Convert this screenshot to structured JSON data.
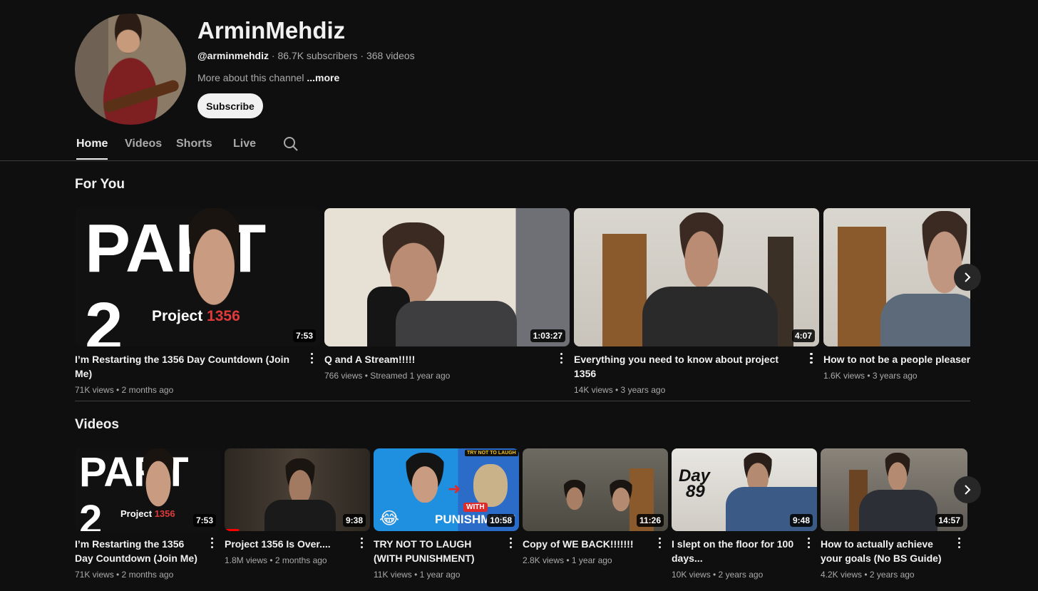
{
  "channel": {
    "name": "ArminMehdiz",
    "handle": "@arminmehdiz",
    "stats": " · 86.7K subscribers · 368 videos",
    "about": "More about this channel ",
    "about_more": "...more",
    "subscribe_label": "Subscribe"
  },
  "tabs": [
    {
      "label": "Home",
      "active": true
    },
    {
      "label": "Videos",
      "active": false
    },
    {
      "label": "Shorts",
      "active": false
    },
    {
      "label": "Live",
      "active": false
    }
  ],
  "sections": {
    "for_you": {
      "title": "For You",
      "videos": [
        {
          "title": "I’m Restarting the 1356 Day Countdown (Join Me)",
          "meta": "71K views • 2 months ago",
          "duration": "7:53",
          "thumb_text": "PART 2",
          "thumb_sub": "Project",
          "thumb_sub_num": "1356"
        },
        {
          "title": "Q and A Stream!!!!!",
          "meta": "766 views • Streamed 1 year ago",
          "duration": "1:03:27"
        },
        {
          "title": "Everything you need to know about project 1356",
          "meta": "14K views • 3 years ago",
          "duration": "4:07"
        },
        {
          "title": "How to not be a people pleaser",
          "meta": "1.6K views • 3 years ago",
          "duration": ""
        }
      ]
    },
    "videos": {
      "title": "Videos",
      "videos": [
        {
          "title": "I’m Restarting the 1356 Day Countdown (Join Me)",
          "meta": "71K views • 2 months ago",
          "duration": "7:53",
          "thumb_text": "PART 2",
          "thumb_sub": "Project",
          "thumb_sub_num": "1356"
        },
        {
          "title": "Project 1356 Is Over....",
          "meta": "1.8M views • 2 months ago",
          "duration": "9:38",
          "progress": 0.1
        },
        {
          "title": "TRY NOT TO LAUGH (WITH PUNISHMENT)",
          "meta": "11K views • 1 year ago",
          "duration": "10:58",
          "thumb_tag": "TRY NOT TO LAUGH",
          "thumb_badge": "WITH",
          "thumb_big": "PUNISHMENT"
        },
        {
          "title": "Copy of WE BACK!!!!!!!",
          "meta": "2.8K views • 1 year ago",
          "duration": "11:26"
        },
        {
          "title": "I slept on the floor for 100 days...",
          "meta": "10K views • 2 years ago",
          "duration": "9:48",
          "thumb_text": "Day",
          "thumb_num": "89"
        },
        {
          "title": "How to actually achieve your goals (No BS Guide)",
          "meta": "4.2K views • 2 years ago",
          "duration": "14:57"
        }
      ]
    }
  },
  "icons": {
    "search": "search-icon",
    "next": "chevron-right-icon",
    "more": "more-vert-icon"
  }
}
